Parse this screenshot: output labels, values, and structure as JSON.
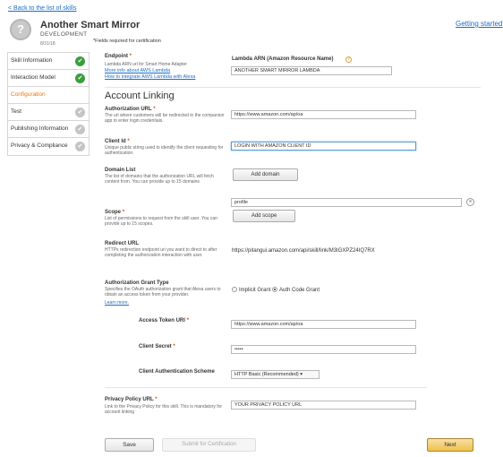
{
  "header": {
    "back_link": "< Back to the list of skills",
    "getting_started": "Getting started",
    "skill_icon": "?",
    "skill_name": "Another Smart Mirror",
    "stage": "DEVELOPMENT",
    "date": "8/31/18",
    "required_note": "*Fields required for certification"
  },
  "sidebar": {
    "items": [
      {
        "label": "Skill Information",
        "status": "complete"
      },
      {
        "label": "Interaction Model",
        "status": "complete"
      },
      {
        "label": "Configuration",
        "status": "active"
      },
      {
        "label": "Test",
        "status": "incomplete"
      },
      {
        "label": "Publishing Information",
        "status": "incomplete"
      },
      {
        "label": "Privacy & Compliance",
        "status": "incomplete"
      }
    ],
    "complete_glyph": "✔",
    "incomplete_glyph": "✔"
  },
  "endpoint": {
    "label": "Endpoint",
    "star": "*",
    "desc": "Lambda ARN url for Smart Home Adapter",
    "link1": "More info about AWS Lambda",
    "link2": "How to integrate AWS Lambda with Alexa",
    "arn_label": "Lambda ARN (Amazon Resource Name)",
    "arn_info": "?",
    "arn_value": "ANOTHER SMART MIRROR  LAMBDA"
  },
  "account_linking": {
    "title": "Account Linking",
    "auth_url": {
      "label": "Authorization URL",
      "star": "*",
      "desc": "The url where customers will be redirected in the companion app to enter login credentials.",
      "value": "https://www.amazon.com/ap/oa"
    },
    "client_id": {
      "label": "Client Id",
      "star": "*",
      "desc": "Unique public string used to identify the client requesting for authentication.",
      "value": "LOGIN WITH AMAZON CLIENT ID"
    },
    "domain_list": {
      "label": "Domain List",
      "desc": "The list of domains that the authorization URL will fetch content from. You can provide up to 15 domains",
      "button": "Add domain"
    },
    "scope": {
      "label": "Scope",
      "star": "*",
      "desc": "List of permissions to request from the skill user. You can provide up to 15 scopes.",
      "value": "profile",
      "remove": "×",
      "button": "Add scope"
    },
    "redirect_url": {
      "label": "Redirect URL",
      "desc": "HTTPs redirection endpoint uri you want to direct to after completing the authorization interaction with user.",
      "value": "https://pitangui.amazon.com/api/skill/link/M3IGXPZ24IQ7RX"
    },
    "grant_type": {
      "label": "Authorization Grant Type",
      "desc": "Specifies the OAuth authorization grant that Alexa users to obtain an access token from your provider.",
      "learn_more": "Learn more.",
      "options": [
        "Implicit Grant",
        "Auth Code Grant"
      ],
      "selected": "Auth Code Grant"
    },
    "access_token_uri": {
      "label": "Access Token URI",
      "star": "*",
      "value": "https://www.amazon.com/ap/oa"
    },
    "client_secret": {
      "label": "Client Secret",
      "star": "*",
      "value": "•••••"
    },
    "client_auth_scheme": {
      "label": "Client Authentication Scheme",
      "value": "HTTP Basic (Recommended)",
      "caret": "▾"
    },
    "privacy_url": {
      "label": "Privacy Policy URL",
      "star": "*",
      "desc": "Link to the Privacy Policy for this skill. This is mandatory for account linking",
      "value": "YOUR PRIVACY POLICY URL"
    }
  },
  "footer": {
    "save": "Save",
    "submit": "Submit for Certification",
    "next": "Next"
  },
  "colors": {
    "accent_orange": "#e47911",
    "complete_green": "#3a9e3e",
    "next_button": "#f0c14b",
    "link_blue": "#1a6ec7"
  }
}
